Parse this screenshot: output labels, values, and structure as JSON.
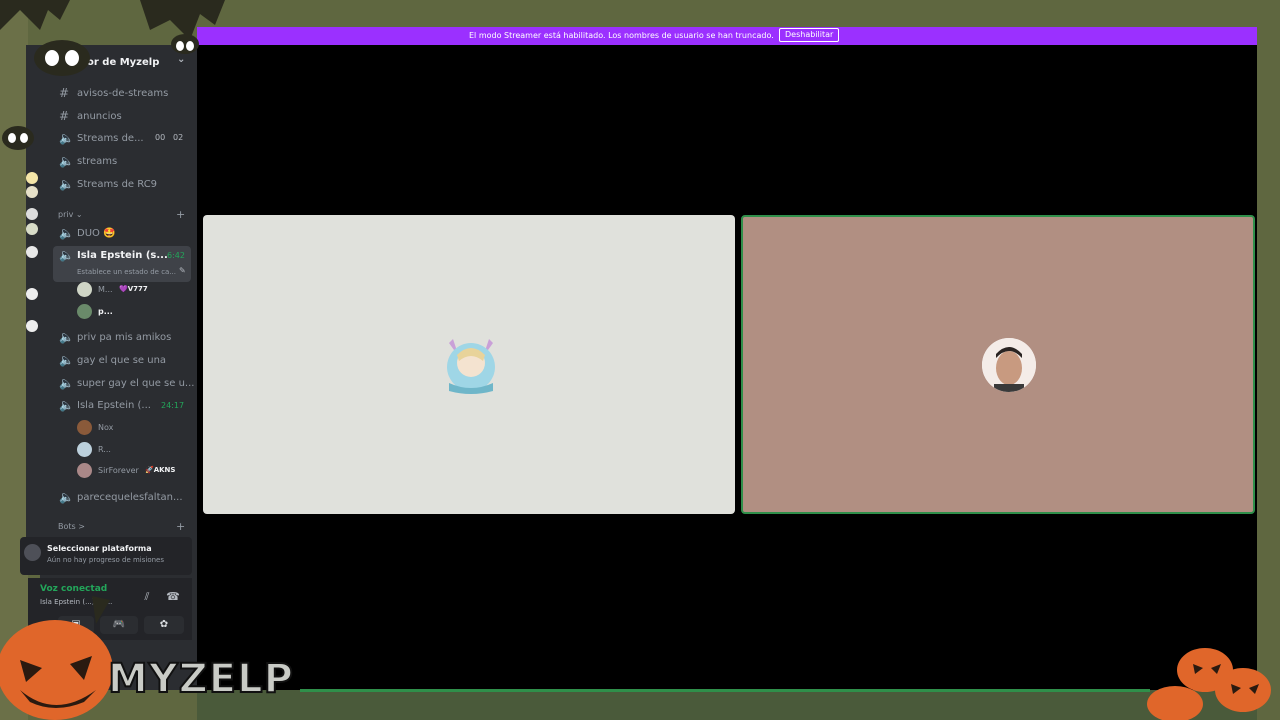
{
  "banner": {
    "message": "El modo Streamer está habilitado. Los nombres de usuario se han truncado.",
    "disable_label": "Deshabilitar"
  },
  "server": {
    "name": "or de Myzelp"
  },
  "channels": [
    {
      "label": "avisos-de-streams",
      "icon": "hash-icon"
    },
    {
      "label": "anuncios",
      "icon": "hash-icon"
    },
    {
      "label": "Streams de...",
      "icon": "speaker-icon",
      "badge1": "00",
      "badge2": "02"
    },
    {
      "label": "streams",
      "icon": "speaker-icon"
    },
    {
      "label": "Streams de RC9",
      "icon": "speaker-icon"
    }
  ],
  "category_priv": {
    "label": "priv ⌄"
  },
  "priv_channels": {
    "duo": "DUO 🤩",
    "isla1": {
      "label": "Isla Epstein (s...",
      "timer": "6:42",
      "status": "Establece un estado de ca..."
    },
    "isla1_users": [
      {
        "name": "M...",
        "tag": "💜V777"
      },
      {
        "name": "p..."
      }
    ],
    "priv_pa": "priv pa mis amikos",
    "gay1": "gay el que se una",
    "gay2": "super gay el que se u...",
    "isla2": {
      "label": "Isla Epstein (...",
      "timer": "24:17"
    },
    "isla2_users": [
      {
        "name": "Nox"
      },
      {
        "name": "R..."
      },
      {
        "name": "SirForever",
        "tag": "🚀AKNS"
      }
    ],
    "parece": "parecequelesfaltan..."
  },
  "category_bots": {
    "label": "Bots >"
  },
  "quest": {
    "title": "Seleccionar plataforma",
    "subtitle": "Aún no hay progreso de misiones"
  },
  "voice": {
    "status": "Voz conectad",
    "channel": "Isla Epstein (...) / S..."
  },
  "overlay": {
    "logo_text": "MYZELP"
  },
  "colors": {
    "banner": "#9b30ff",
    "voice_green": "#23a55a",
    "tile_a": "#e0e1dc",
    "tile_b": "#b18f82"
  }
}
